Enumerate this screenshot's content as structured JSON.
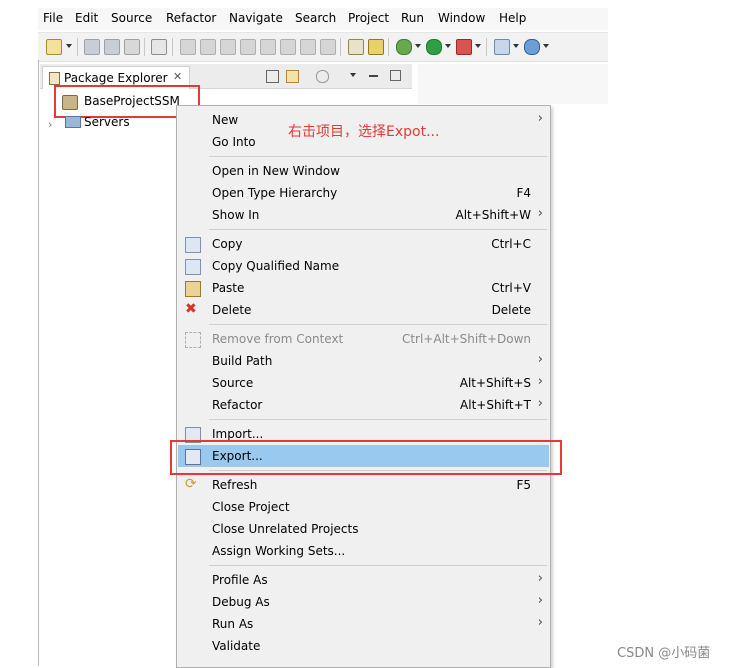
{
  "menubar": {
    "items": [
      "File",
      "Edit",
      "Source",
      "Refactor",
      "Navigate",
      "Search",
      "Project",
      "Run",
      "Window",
      "Help"
    ]
  },
  "package_explorer": {
    "tab_label": "Package Explorer",
    "close_glyph": "✕",
    "tree": {
      "project": "BaseProjectSSM",
      "servers": "Servers"
    }
  },
  "annotation": "右击项目，选择Expot...",
  "context_menu": {
    "items": [
      {
        "label": "New",
        "submenu": true
      },
      {
        "label": "Go Into"
      },
      {
        "label": "Open in New Window"
      },
      {
        "label": "Open Type Hierarchy",
        "accel": "F4"
      },
      {
        "label": "Show In",
        "accel": "Alt+Shift+W",
        "submenu": true
      },
      {
        "label": "Copy",
        "accel": "Ctrl+C",
        "icon": "copy-icon"
      },
      {
        "label": "Copy Qualified Name",
        "icon": "copy-qualified-name-icon"
      },
      {
        "label": "Paste",
        "accel": "Ctrl+V",
        "icon": "paste-icon"
      },
      {
        "label": "Delete",
        "accel": "Delete",
        "icon": "delete-icon"
      },
      {
        "label": "Remove from Context",
        "accel": "Ctrl+Alt+Shift+Down",
        "disabled": true,
        "icon": "remove-from-context-icon"
      },
      {
        "label": "Build Path",
        "submenu": true
      },
      {
        "label": "Source",
        "accel": "Alt+Shift+S",
        "submenu": true
      },
      {
        "label": "Refactor",
        "accel": "Alt+Shift+T",
        "submenu": true
      },
      {
        "label": "Import...",
        "icon": "import-icon"
      },
      {
        "label": "Export...",
        "icon": "export-icon",
        "highlighted": true
      },
      {
        "label": "Refresh",
        "accel": "F5",
        "icon": "refresh-icon"
      },
      {
        "label": "Close Project"
      },
      {
        "label": "Close Unrelated Projects"
      },
      {
        "label": "Assign Working Sets..."
      },
      {
        "label": "Profile As",
        "submenu": true
      },
      {
        "label": "Debug As",
        "submenu": true
      },
      {
        "label": "Run As",
        "submenu": true
      },
      {
        "label": "Validate"
      }
    ]
  },
  "watermark": "CSDN @小码菌",
  "colors": {
    "annotation_red": "#e53935",
    "highlight": "#99c9ef",
    "menu_bg": "#f0f0f0"
  }
}
